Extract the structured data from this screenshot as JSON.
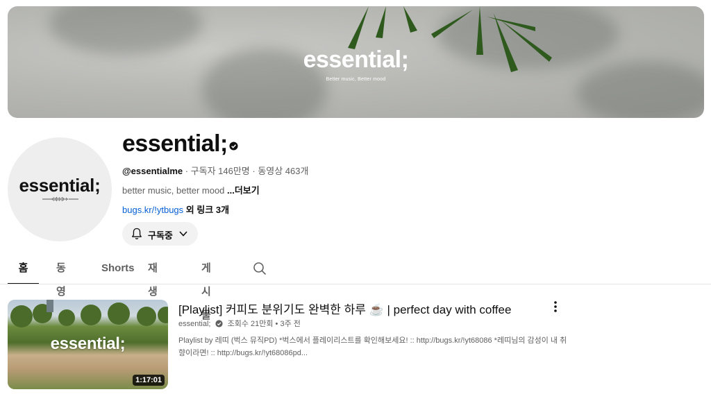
{
  "banner": {
    "logo": "essential;",
    "tagline": "Better music, Better mood"
  },
  "avatar": {
    "logo": "essential;"
  },
  "channel": {
    "name": "essential;",
    "handle": "@essentialme",
    "meta_rest": " · 구독자 146만명 · 동영상 463개",
    "description": "better music, better mood ",
    "more_label": "...더보기",
    "link_text": "bugs.kr/!ytbugs",
    "extra_links": " 외 링크 3개",
    "subscribe_label": "구독중",
    "icons": {
      "verified": "verified-check-icon",
      "bell": "bell-icon",
      "chevron": "chevron-down-icon"
    }
  },
  "tabs": [
    {
      "label": "홈",
      "active": true
    },
    {
      "label": "동영상",
      "active": false
    },
    {
      "label": "Shorts",
      "active": false
    },
    {
      "label": "재생목록",
      "active": false
    },
    {
      "label": "게시물",
      "active": false
    }
  ],
  "video": {
    "thumb_logo": "essential;",
    "duration": "1:17:01",
    "title": "[Playlist] 커피도 분위기도 완벽한 하루 ☕ | perfect day with coffee",
    "channel": "essential;",
    "stats": "조회수 21만회 • 3주 전",
    "description": "Playlist by 레띠 (벅스 뮤직PD) *벅스에서 플레이리스트를 확인해보세요! :: http://bugs.kr/!yt68086 *레띠님의 감성이 내 취향이라면! :: http://bugs.kr/!yt68086pd..."
  }
}
